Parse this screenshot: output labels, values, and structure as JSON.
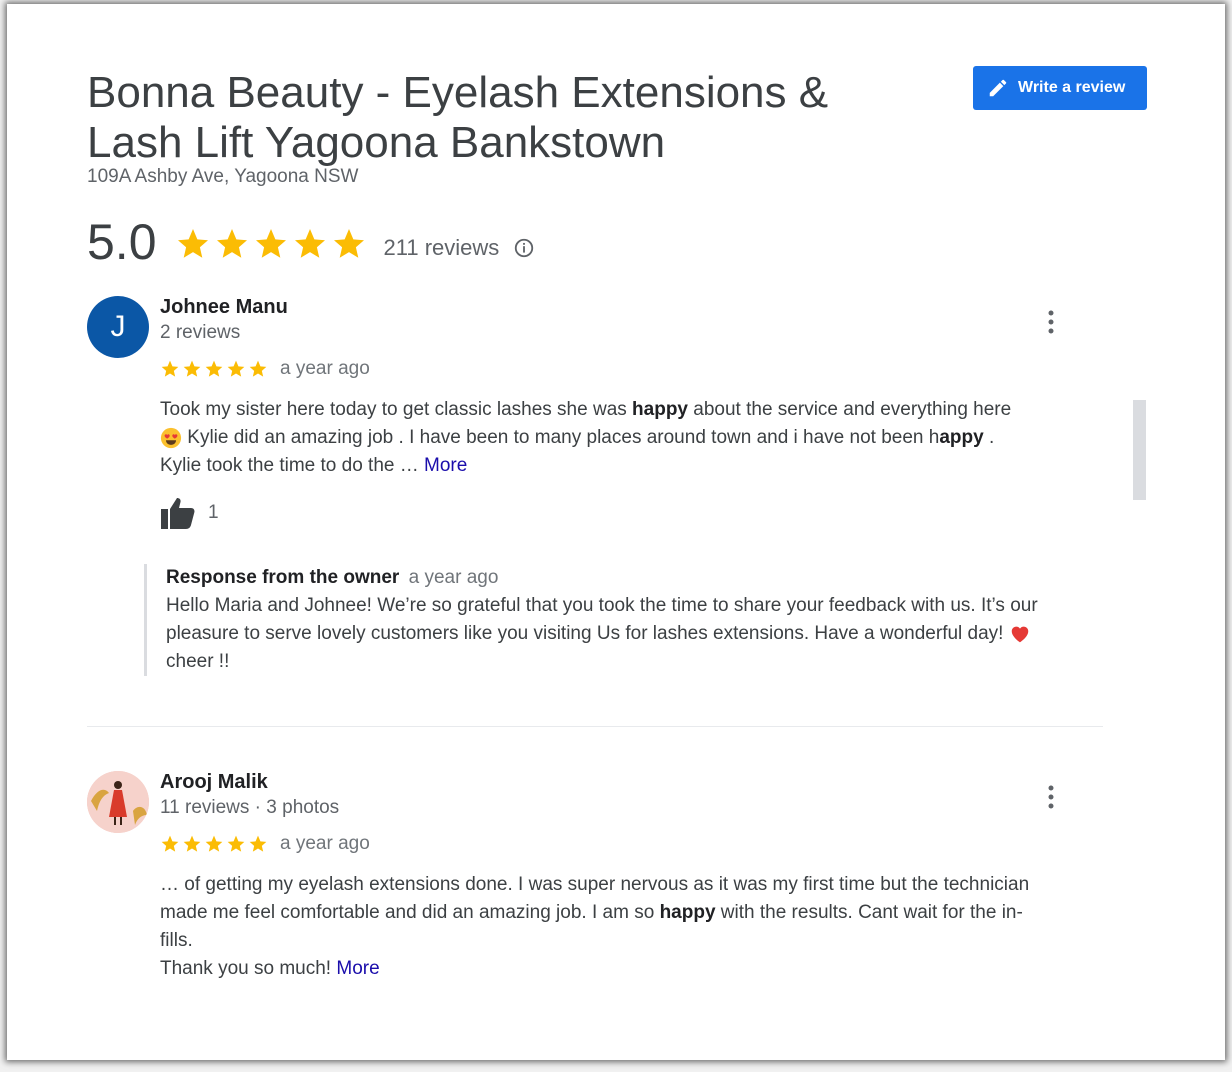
{
  "business": {
    "title": "Bonna Beauty - Eyelash Extensions & Lash Lift Yagoona Bankstown",
    "address": "109A Ashby Ave, Yagoona NSW",
    "rating": "5.0",
    "stars": 5,
    "review_count": "211 reviews",
    "write_review_label": "Write a review"
  },
  "reviews": [
    {
      "avatar_letter": "J",
      "name": "Johnee Manu",
      "meta": "2 reviews",
      "stars": 5,
      "when": "a year ago",
      "text_1": "Took my sister here today to get classic lashes she was ",
      "text_1_bold": "happy",
      "text_1b": " about the service and everything here",
      "text_2": " Kylie did an amazing job . I have been to many places around town and i have not been h",
      "text_2_bold": "appy",
      "text_2b": " .",
      "text_3": "Kylie took the time to do the … ",
      "more_label": "More",
      "likes": "1",
      "owner_label": "Response from the owner",
      "owner_when": "a year ago",
      "owner_text_1": "Hello Maria and Johnee! We’re so grateful that you took the time to share your feedback with us. It’s our",
      "owner_text_2": "pleasure to serve lovely customers like you visiting Us for lashes extensions. Have a wonderful day! ",
      "owner_text_3": "cheer !!"
    },
    {
      "name": "Arooj Malik",
      "meta": "11 reviews · 3 photos",
      "stars": 5,
      "when": "a year ago",
      "text_1": "… of getting my eyelash extensions done. I was super nervous as it was my first time but the technician",
      "text_2": "made me feel comfortable and did an amazing job. I am so ",
      "text_2_bold": "happy",
      "text_2b": " with the results. Cant wait for the in-",
      "text_3": "fills.",
      "text_4": "Thank you so much! ",
      "more_label": "More"
    }
  ],
  "colors": {
    "accent": "#1a73e8",
    "star": "#fbbc04",
    "link": "#1a0dab"
  },
  "icons": [
    "pencil-icon",
    "star-icon",
    "info-icon",
    "more-vert-icon",
    "thumbs-up-icon",
    "heart-eyes-emoji",
    "red-heart-emoji"
  ]
}
